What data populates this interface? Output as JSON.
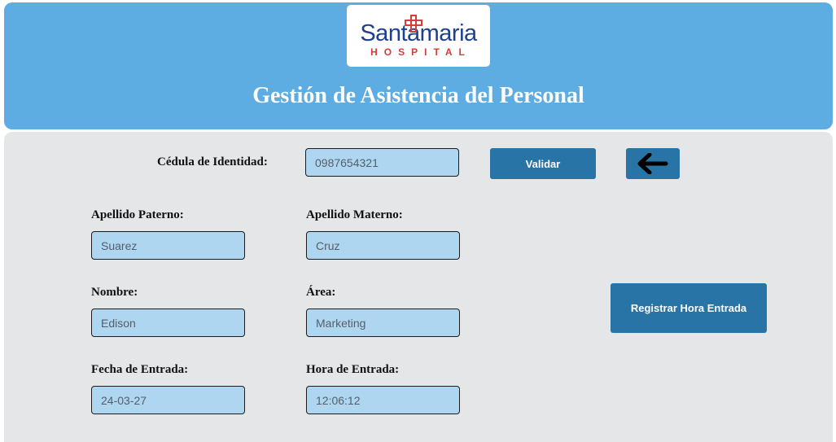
{
  "header": {
    "logo": {
      "name": "Santamaria",
      "subtitle": "HOSPITAL"
    },
    "title": "Gestión de Asistencia del Personal",
    "background_color": "#5dade2"
  },
  "form": {
    "cedula": {
      "label": "Cédula de Identidad:",
      "value": "0987654321"
    },
    "validar_label": "Validar",
    "back_icon": "arrow-left-icon",
    "apellido_paterno": {
      "label": "Apellido Paterno:",
      "value": "Suarez"
    },
    "apellido_materno": {
      "label": "Apellido Materno:",
      "value": "Cruz"
    },
    "nombre": {
      "label": "Nombre:",
      "value": "Edison"
    },
    "area": {
      "label": "Área:",
      "value": "Marketing"
    },
    "fecha_entrada": {
      "label": "Fecha de Entrada:",
      "value": "24-03-27"
    },
    "hora_entrada": {
      "label": "Hora de Entrada:",
      "value": "12:06:12"
    },
    "registrar_label": "Registrar Hora Entrada"
  },
  "colors": {
    "button": "#2874a6",
    "field": "#aed6f1",
    "panel": "#e5e6e8"
  }
}
